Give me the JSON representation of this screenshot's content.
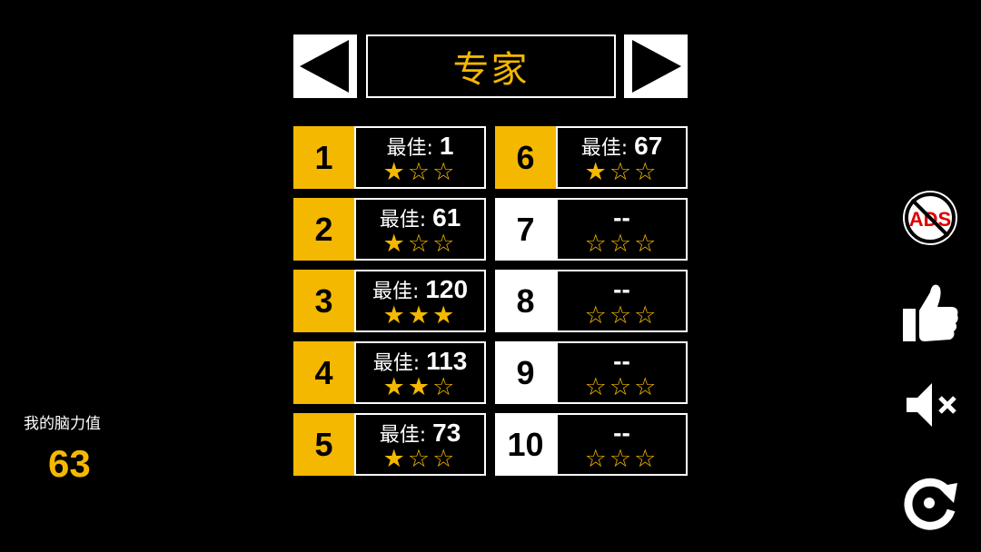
{
  "header": {
    "title": "专家",
    "prev_icon": "triangle-left-icon",
    "next_icon": "triangle-right-icon"
  },
  "levels": [
    {
      "number": "1",
      "best_label": "最佳: ",
      "best": "1",
      "stars": 1,
      "unlocked": true
    },
    {
      "number": "2",
      "best_label": "最佳: ",
      "best": "61",
      "stars": 1,
      "unlocked": true
    },
    {
      "number": "3",
      "best_label": "最佳: ",
      "best": "120",
      "stars": 3,
      "unlocked": true
    },
    {
      "number": "4",
      "best_label": "最佳: ",
      "best": "113",
      "stars": 2,
      "unlocked": true
    },
    {
      "number": "5",
      "best_label": "最佳: ",
      "best": "73",
      "stars": 1,
      "unlocked": true
    },
    {
      "number": "6",
      "best_label": "最佳: ",
      "best": "67",
      "stars": 1,
      "unlocked": true
    },
    {
      "number": "7",
      "best_label": "",
      "best": "--",
      "stars": 0,
      "unlocked": false
    },
    {
      "number": "8",
      "best_label": "",
      "best": "--",
      "stars": 0,
      "unlocked": false
    },
    {
      "number": "9",
      "best_label": "",
      "best": "--",
      "stars": 0,
      "unlocked": false
    },
    {
      "number": "10",
      "best_label": "",
      "best": "--",
      "stars": 0,
      "unlocked": false
    }
  ],
  "brain": {
    "label": "我的脑力值",
    "value": "63"
  },
  "side_icons": {
    "no_ads_text": "ADS",
    "no_ads_icon": "no-ads-icon",
    "like_icon": "thumbs-up-icon",
    "mute_icon": "speaker-muted-icon",
    "restart_icon": "restart-icon"
  },
  "colors": {
    "accent": "#F5B800",
    "background": "#000000",
    "locked": "#FFFFFF",
    "ads_red": "#E00000"
  }
}
